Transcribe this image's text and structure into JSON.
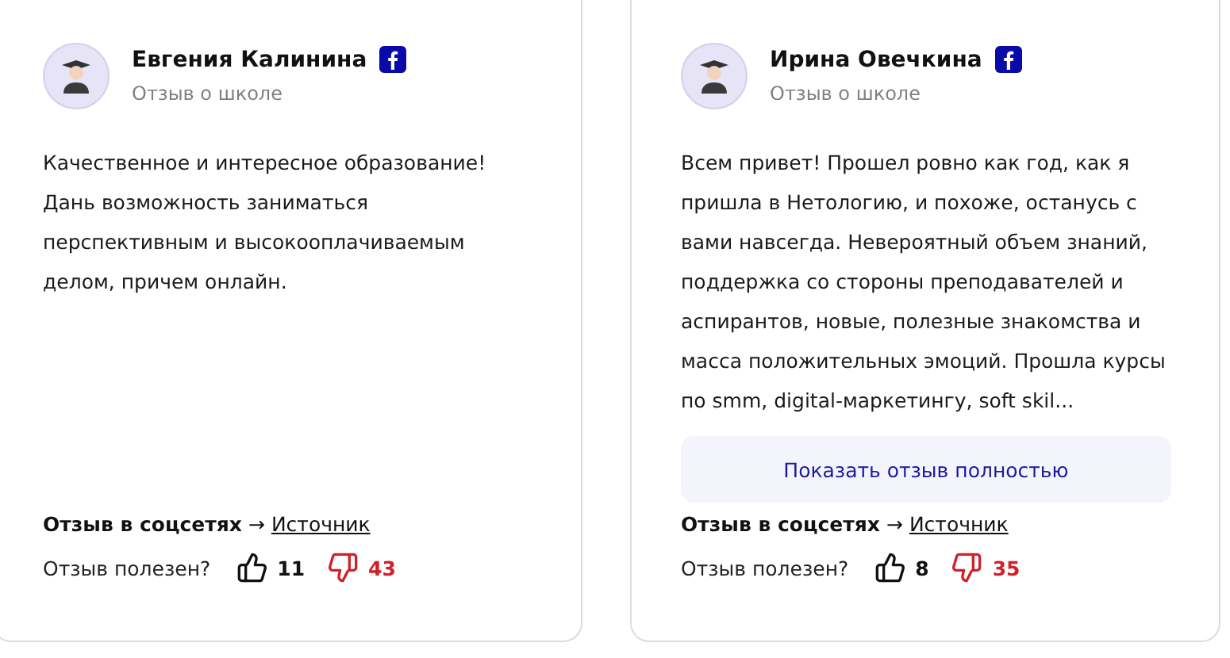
{
  "reviews": [
    {
      "author": "Евгения Калинина",
      "subtitle": "Отзыв о школе",
      "text": "Качественное и интересное образование! Дань возможность заниматься перспективным и высокооплачиваемым делом, причем онлайн.",
      "social_label": "Отзыв в соцсетях",
      "arrow": "→",
      "source_link": "Источник",
      "helpful_label": "Отзыв полезен?",
      "likes": "11",
      "dislikes": "43"
    },
    {
      "author": "Ирина Овечкина",
      "subtitle": "Отзыв о школе",
      "text": "Всем привет! Прошел ровно как год, как я пришла в Нетологию, и похоже, останусь с вами навсегда. Невероятный объем знаний, поддержка со стороны преподавателей и аспирантов, новые, полезные знакомства и масса положительных эмоций. Прошла курсы по smm, digital-маркетингу, soft skil...",
      "show_more_button": "Показать отзыв полностью",
      "social_label": "Отзыв в соцсетях",
      "arrow": "→",
      "source_link": "Источник",
      "helpful_label": "Отзыв полезен?",
      "likes": "8",
      "dislikes": "35"
    }
  ]
}
